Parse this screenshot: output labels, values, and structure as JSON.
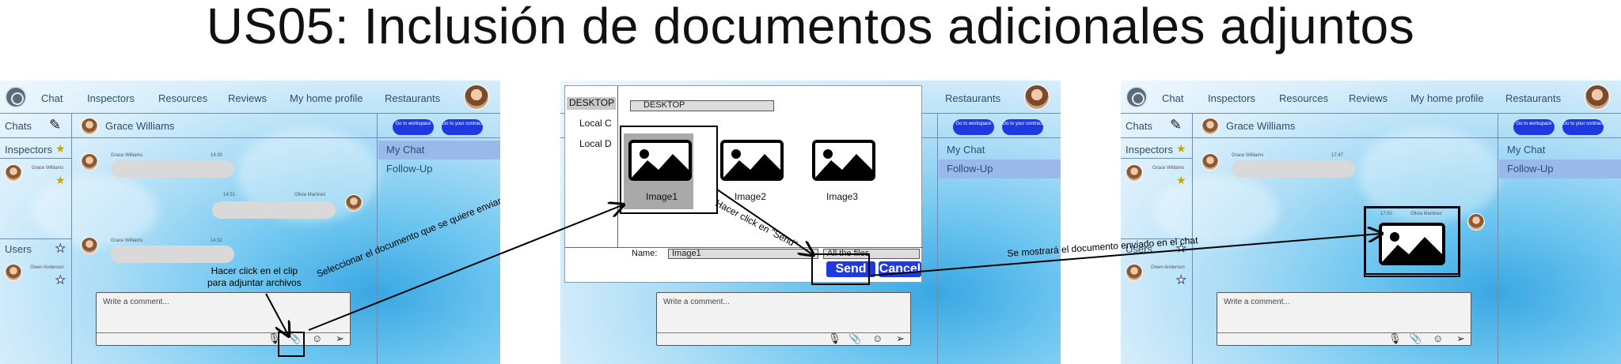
{
  "title": "US05: Inclusión de documentos adicionales adjuntos",
  "nav": {
    "items": [
      "Chat",
      "Inspectors",
      "Resources",
      "Reviews",
      "My home profile",
      "Restaurants"
    ]
  },
  "chat": {
    "chats_label": "Chats",
    "contact_name": "Grace Williams",
    "go_to_workspace": "Go to workspace",
    "go_to_contract": "Go to your contract",
    "inspectors_label": "Inspectors",
    "users_label": "Users",
    "inspector_name": "Grace Williams",
    "user_name": "Owen Anderson",
    "my_chat": "My Chat",
    "follow_up": "Follow-Up",
    "comment_placeholder": "Write a comment...",
    "messages_1": [
      {
        "sender": "Grace Williams",
        "time": "14:30"
      },
      {
        "sender": "Olivia Martinez",
        "time": "14:31"
      },
      {
        "sender": "Grace Williams",
        "time": "14:32"
      }
    ],
    "messages_3": [
      {
        "sender": "Grace Williams",
        "time": "17:47"
      },
      {
        "sender": "Olivia Martinez",
        "time": "17:50"
      }
    ]
  },
  "dialog": {
    "location_selected": "DESKTOP",
    "locations": [
      "DESKTOP",
      "Local C",
      "Local D"
    ],
    "path": "DESKTOP",
    "files": [
      "Image1",
      "Image2",
      "Image3"
    ],
    "name_label": "Name:",
    "name_value": "Image1",
    "filter_value": "All the files",
    "send_label": "Send",
    "cancel_label": "Cancel"
  },
  "annotations": {
    "click_clip": "Hacer click en el clip\npara adjuntar archivos",
    "select_document": "Seleccionar el documento que se quiere enviar",
    "click_send": "Hacer click en \"Send\"",
    "document_shown": "Se mostrará el documento enviado en el chat"
  },
  "colors": {
    "accent": "#1f39e0",
    "selected_row": "#9bb8ea"
  }
}
